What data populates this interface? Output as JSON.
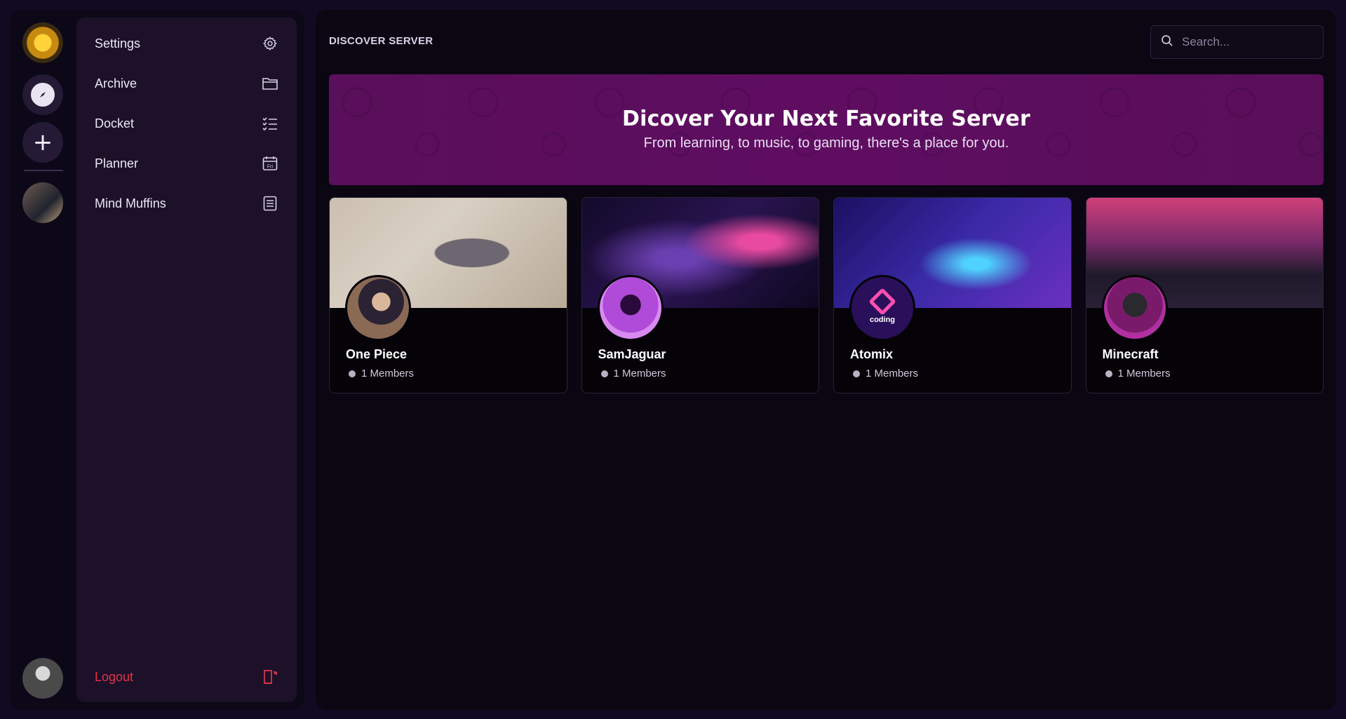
{
  "sidebar": {
    "items": [
      {
        "label": "Settings",
        "icon": "gear-icon"
      },
      {
        "label": "Archive",
        "icon": "folder-icon"
      },
      {
        "label": "Docket",
        "icon": "checklist-icon"
      },
      {
        "label": "Planner",
        "icon": "calendar-icon",
        "icon_text": "Fri"
      },
      {
        "label": "Mind Muffins",
        "icon": "document-icon"
      }
    ],
    "logout_label": "Logout"
  },
  "header": {
    "title": "DISCOVER SERVER",
    "search_placeholder": "Search..."
  },
  "hero": {
    "title": "Dicover Your Next Favorite Server",
    "subtitle": "From learning, to music, to gaming, there's a place for you."
  },
  "servers": [
    {
      "name": "One Piece",
      "members": "1 Members"
    },
    {
      "name": "SamJaguar",
      "members": "1 Members"
    },
    {
      "name": "Atomix",
      "members": "1 Members",
      "avatar_text": "coding"
    },
    {
      "name": "Minecraft",
      "members": "1 Members"
    }
  ],
  "colors": {
    "accent": "#5e0d61",
    "logout": "#e0354a",
    "background": "#0a0612"
  }
}
